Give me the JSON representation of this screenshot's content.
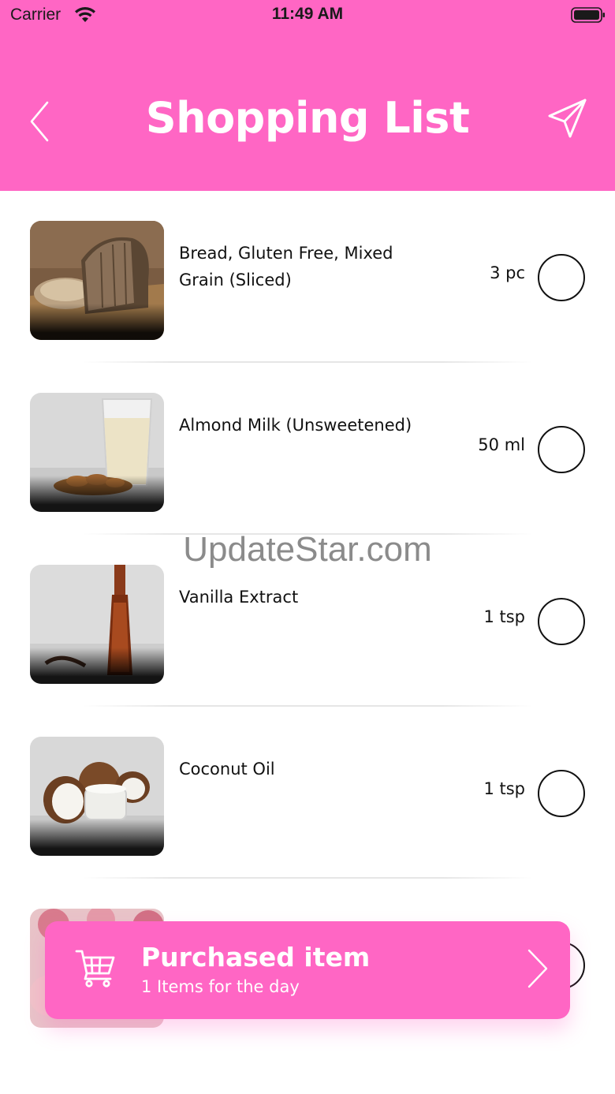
{
  "status_bar": {
    "carrier": "Carrier",
    "time": "11:49 AM"
  },
  "header": {
    "title": "Shopping List",
    "back_icon": "chevron-left-icon",
    "send_icon": "paper-plane-icon"
  },
  "items": [
    {
      "name": "Bread, Gluten Free, Mixed Grain (Sliced)",
      "qty": "3 pc",
      "checked": false,
      "image": "bread"
    },
    {
      "name": "Almond Milk (Unsweetened)",
      "qty": "50 ml",
      "checked": false,
      "image": "milk"
    },
    {
      "name": "Vanilla Extract",
      "qty": "1 tsp",
      "checked": false,
      "image": "vanilla"
    },
    {
      "name": "Coconut Oil",
      "qty": "1 tsp",
      "checked": false,
      "image": "coconut"
    }
  ],
  "watermark": "UpdateStar.com",
  "purchased": {
    "title": "Purchased item",
    "subtitle": "1 Items for the day",
    "icon": "shopping-cart-icon"
  },
  "colors": {
    "accent": "#ff66c4",
    "header_text": "#ffffff"
  }
}
